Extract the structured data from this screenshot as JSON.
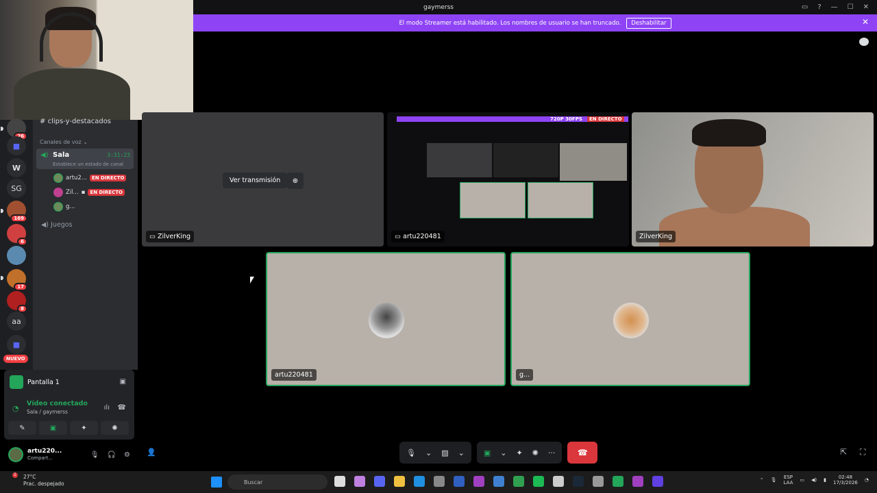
{
  "window": {
    "title": "gaymerss"
  },
  "banner": {
    "text": "El modo Streamer está habilitado. Los nombres de usuario se han truncado.",
    "button": "Deshabilitar"
  },
  "sidebar": {
    "text_channel": "clips-y-destacados",
    "voice_category": "Canales de voz",
    "room": {
      "name": "Sala",
      "timer": "3:31:23",
      "status_prompt": "Establece un estado de canal"
    },
    "members": [
      {
        "name": "artu2...",
        "badge": "EN DIRECTO"
      },
      {
        "name": "Zil...",
        "badge": "EN DIRECTO"
      },
      {
        "name": "g...",
        "badge": ""
      }
    ],
    "other_channel": "Juegos"
  },
  "rail": {
    "badges": [
      "26",
      "169",
      "6",
      "17",
      "8"
    ],
    "labels": [
      "SG",
      "aa"
    ],
    "new_label": "NUEVO"
  },
  "voice_panel": {
    "screen_label": "Pantalla 1",
    "connection": "Vídeo conectado",
    "location": "Sala / gaymerss"
  },
  "user": {
    "name": "artu220...",
    "status": "Compart..."
  },
  "tiles": [
    {
      "label": "ZilverKing",
      "action": "Ver transmisión"
    },
    {
      "label": "artu220481",
      "quality": "720P 30FPS",
      "live": "EN DIRECTO"
    },
    {
      "label": "ZilverKing"
    },
    {
      "label": "artu220481"
    },
    {
      "label": "g..."
    }
  ],
  "taskbar": {
    "weather_temp": "27°C",
    "weather_desc": "Prac. despejado",
    "weather_badge": "1",
    "search_placeholder": "Buscar",
    "lang": "ESP",
    "layout": "LAA",
    "time": "02:48",
    "date": "17/3/2026"
  },
  "colors": {
    "accent": "#8e44f5",
    "live": "#da373c",
    "connected": "#23a55a"
  }
}
